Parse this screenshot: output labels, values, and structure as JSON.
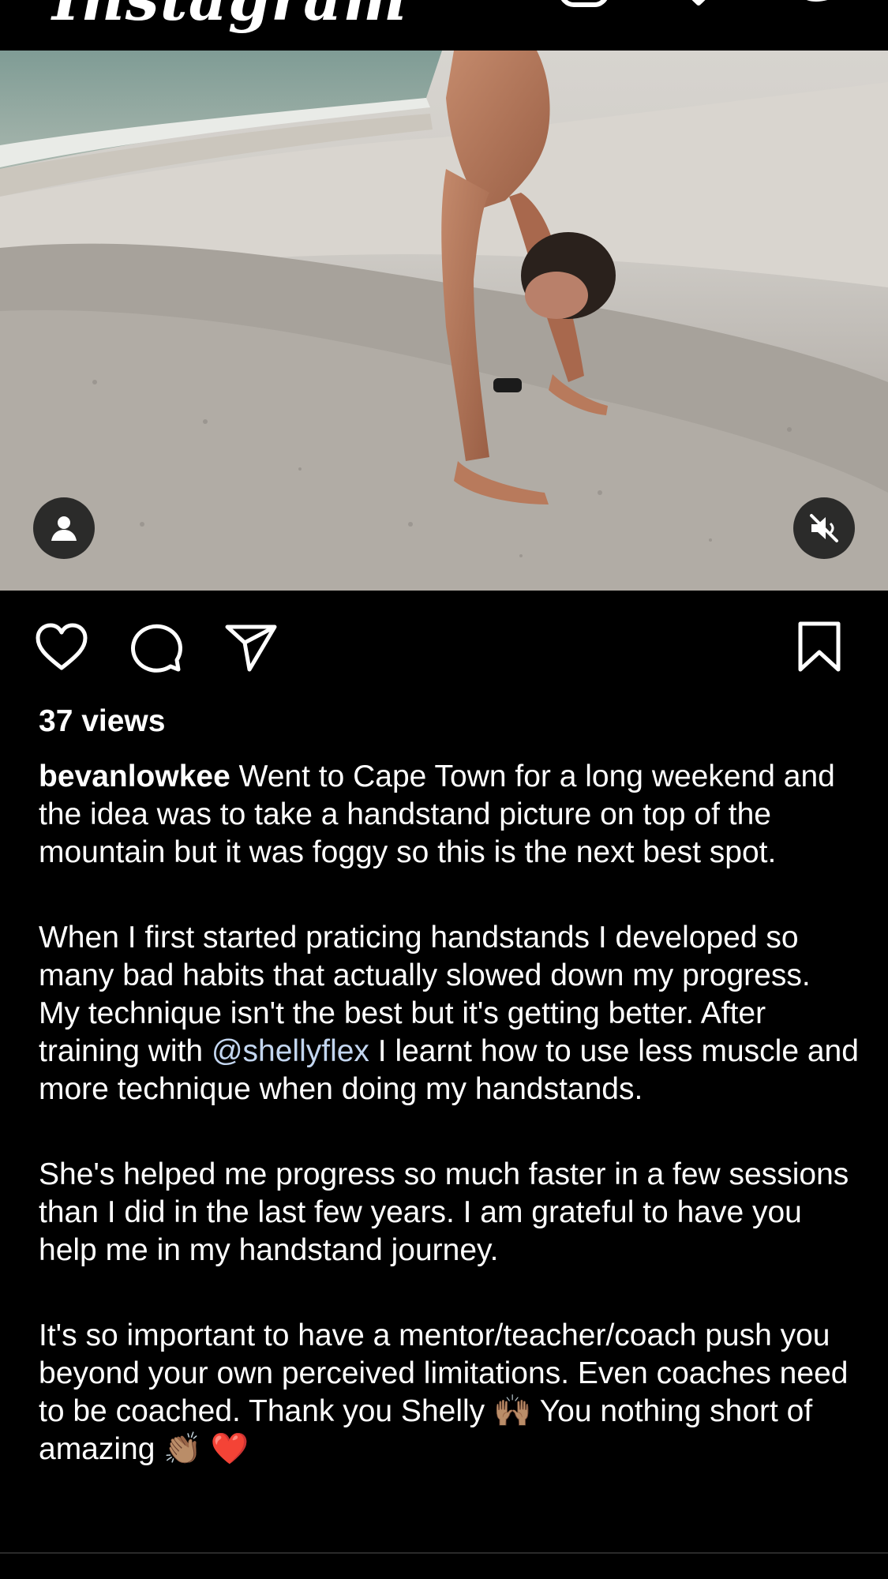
{
  "header": {
    "logo_text": "Instagram",
    "icons": [
      "add-post-icon",
      "heart-icon",
      "messenger-icon"
    ]
  },
  "media": {
    "overlay_left_icon": "person-tag-icon",
    "overlay_right_icon": "muted-speaker-icon"
  },
  "actions": {
    "icons": [
      "like-icon",
      "comment-icon",
      "share-icon",
      "bookmark-icon"
    ]
  },
  "post": {
    "views": "37 views",
    "username": "bevanlowkee",
    "p1_text": " Went to Cape Town for a long weekend and the idea was to take a handstand picture on top of the mountain but it was foggy so this is the next best spot.",
    "p2_before": "When I first started praticing handstands I developed so many bad habits that actually slowed down my progress. My technique isn't the best but it's getting better. After training with ",
    "p2_mention": "@shellyflex",
    "p2_after": " I learnt how to use less muscle and more technique when doing my handstands.",
    "p3_text": "She's helped me progress so much faster in a few sessions than I did in the last few years. I am grateful to have you help me in my handstand journey.",
    "p4_text": "It's so important to have a mentor/teacher/coach push you beyond your own perceived limitations. Even coaches need to be coached. Thank you Shelly ",
    "p4_emoji_hands": "🙌🏽",
    "p4_tail": " You nothing short of amazing ",
    "p4_emoji_clap": "👏🏽",
    "p4_emoji_heart": "❤️"
  },
  "colors": {
    "background": "#000000",
    "text": "#ffffff",
    "mention": "#c3d6f0"
  }
}
